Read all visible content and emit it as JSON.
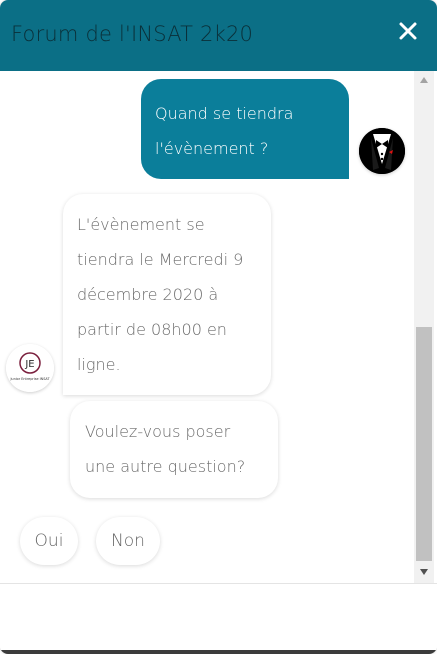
{
  "header": {
    "title": "Forum de l'INSAT 2k20",
    "close_icon": "close-icon"
  },
  "colors": {
    "header_bg": "#0b6f86",
    "user_bubble": "#0b7e9a",
    "bot_bubble": "#ffffff"
  },
  "messages": [
    {
      "from": "user",
      "text": "Quand se tiendra l'évènement ?"
    },
    {
      "from": "bot",
      "text": "L'évènement se tiendra le Mercredi 9 décembre 2020 à partir de 08h00 en ligne."
    },
    {
      "from": "bot",
      "text": "Voulez-vous poser une autre question?"
    }
  ],
  "quick_replies": [
    "Oui",
    "Non"
  ],
  "bot_avatar": {
    "logo_text": "JE",
    "caption": "Junior Entreprise INSAT"
  },
  "user_avatar": {
    "icon": "tuxedo-icon"
  }
}
